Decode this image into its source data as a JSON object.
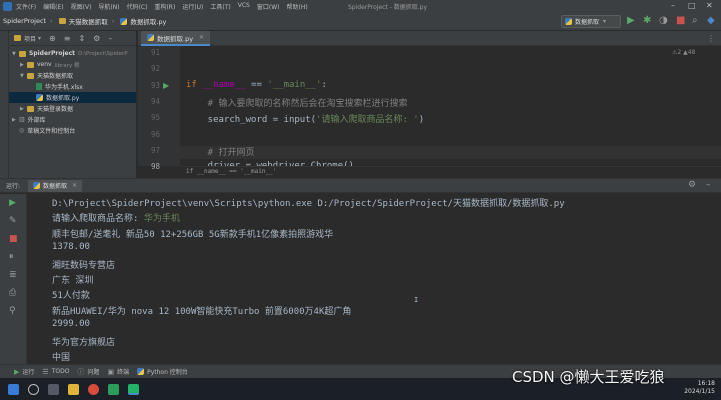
{
  "menu": {
    "items": [
      "文件(F)",
      "编辑(E)",
      "视图(V)",
      "导航(N)",
      "代码(C)",
      "重构(R)",
      "运行(U)",
      "工具(T)",
      "VCS",
      "窗口(W)",
      "帮助(H)"
    ],
    "window_title": "SpiderProject - 数据抓取.py"
  },
  "breadcrumbs": [
    "SpiderProject",
    "天猫数据抓取",
    "数据抓取.py"
  ],
  "run_config": "数据抓取",
  "project_panel": {
    "title": "项目",
    "root": "SpiderProject",
    "root_path": "D:\\Project\\SpiderP",
    "items": [
      {
        "label": "venv",
        "note": "library 根",
        "level": 1
      },
      {
        "label": "天猫数据抓取",
        "level": 1
      },
      {
        "label": "华为手机.xlsx",
        "level": 2
      },
      {
        "label": "数据抓取.py",
        "level": 2,
        "selected": true
      },
      {
        "label": "天猫登录数据",
        "level": 1
      },
      {
        "label": "外部库",
        "level": 0
      },
      {
        "label": "草稿文件和控制台",
        "level": 0
      }
    ]
  },
  "editor": {
    "tab": "数据抓取.py",
    "hint": "⚠2 ▲48",
    "line_numbers": [
      "91",
      "92",
      "93",
      "94",
      "95",
      "96",
      "97",
      "98"
    ],
    "lines": [
      {
        "parts": []
      },
      {
        "parts": []
      },
      {
        "parts": [
          {
            "t": "if ",
            "c": "kw"
          },
          {
            "t": "__name__",
            "c": "dn"
          },
          {
            "t": " == ",
            "c": ""
          },
          {
            "t": "'__main__'",
            "c": "st"
          },
          {
            "t": ":",
            "c": ""
          }
        ]
      },
      {
        "parts": [
          {
            "t": "    # 输入要爬取的名称然后会在淘宝搜索栏进行搜索",
            "c": "cm"
          }
        ]
      },
      {
        "parts": [
          {
            "t": "    search_word = input(",
            "c": ""
          },
          {
            "t": "'请输入爬取商品名称: '",
            "c": "st"
          },
          {
            "t": ")",
            "c": ""
          }
        ]
      },
      {
        "parts": []
      },
      {
        "parts": [
          {
            "t": "    # 打开网页",
            "c": "cm"
          }
        ]
      },
      {
        "parts": [
          {
            "t": "    driver = webdriver.Chrome()",
            "c": ""
          }
        ]
      }
    ],
    "breadcrumb": "if __name__ == '__main__'"
  },
  "run_panel": {
    "label": "运行:",
    "tab": "数据抓取",
    "output": [
      {
        "text": "D:\\Project\\SpiderProject\\venv\\Scripts\\python.exe D:/Project/SpiderProject/天猫数据抓取/数据抓取.py"
      },
      {
        "text": "请输入爬取商品名称: ",
        "input": "华为手机"
      },
      {
        "text": "顺丰包邮/送耄礼 新品50 12+256GB 5G新款手机1亿像素拍照游戏华"
      },
      {
        "text": "1378.00"
      },
      {
        "text": "湘旺数码专营店"
      },
      {
        "text": "广东 深圳"
      },
      {
        "text": "51人付款"
      },
      {
        "text": "新品HUAWEI/华为 nova 12 100W智能快充Turbo 前置6000万4K超广角"
      },
      {
        "text": "2999.00"
      },
      {
        "text": "华为官方旗舰店"
      },
      {
        "text": "中国"
      }
    ]
  },
  "bottom_tabs": [
    "运行",
    "TODO",
    "问题",
    "终端",
    "Python 控制台"
  ],
  "tray": {
    "time": "16:18",
    "date": "2024/1/15"
  },
  "watermark": "CSDN @懒大王爱吃狼"
}
